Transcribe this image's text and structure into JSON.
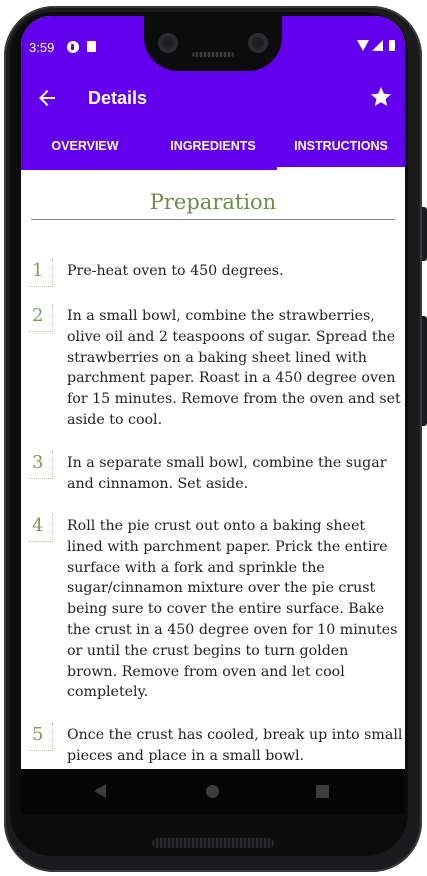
{
  "status": {
    "time": "3:59",
    "icons": [
      "play-protect-icon",
      "sd-card-icon",
      "wifi-icon",
      "cell-signal-icon",
      "battery-icon"
    ]
  },
  "app_bar": {
    "title": "Details",
    "back_icon": "arrow-back-icon",
    "favorite_icon": "star-icon"
  },
  "tabs": [
    {
      "label": "OVERVIEW",
      "active": false
    },
    {
      "label": "INGREDIENTS",
      "active": false
    },
    {
      "label": "INSTRUCTIONS",
      "active": true
    }
  ],
  "preparation": {
    "heading": "Preparation",
    "steps": [
      {
        "num": "1",
        "text": "Pre-heat oven to 450 degrees."
      },
      {
        "num": "2",
        "text": "In a small bowl, combine the strawberries, olive oil and 2 teaspoons of sugar. Spread the strawberries on a baking sheet lined with parchment paper. Roast in a 450 degree oven for 15 minutes. Remove from the oven and set aside to cool."
      },
      {
        "num": "3",
        "text": "In a separate small bowl, combine the sugar and cinnamon. Set aside."
      },
      {
        "num": "4",
        "text": "Roll the pie crust out onto a baking sheet lined with parchment paper. Prick the entire surface with a fork and sprinkle the sugar/cinnamon mixture over the pie crust being sure to cover the entire surface. Bake the crust in a 450 degree oven for 10 minutes or until the crust begins to turn golden brown. Remove from oven and let cool completely."
      },
      {
        "num": "5",
        "text": "Once the crust has cooled, break up into small pieces and place in a small bowl."
      }
    ]
  },
  "colors": {
    "primary": "#6200ee",
    "accent_green": "#6a8f49"
  }
}
